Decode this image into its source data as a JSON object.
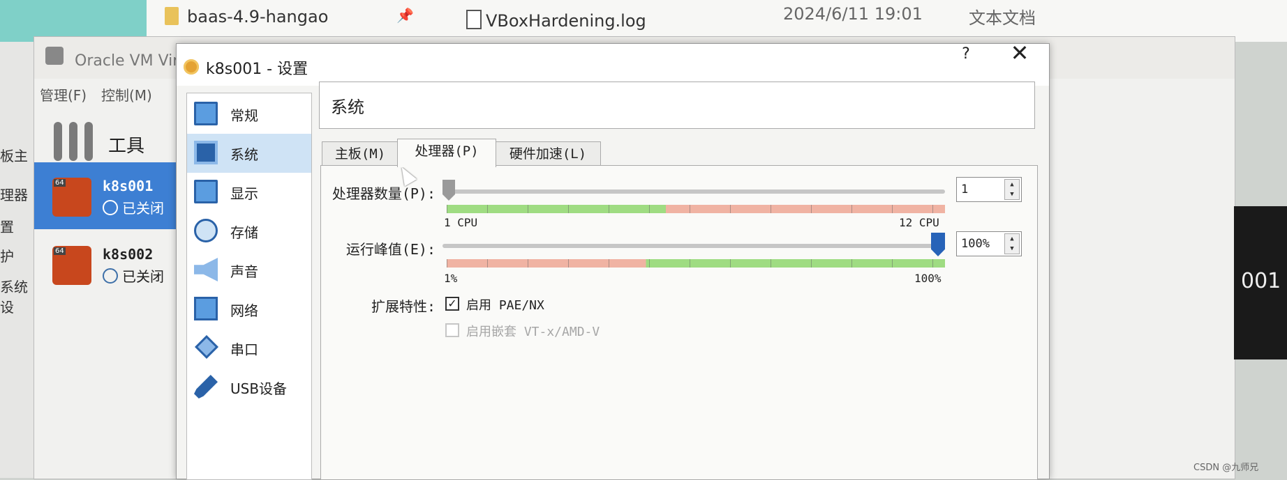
{
  "explorer": {
    "folder_name": "baas-4.9-hangao",
    "file_name": "VBoxHardening.log",
    "file_date": "2024/6/11 19:01",
    "file_type": "文本文档"
  },
  "manager": {
    "title": "Oracle VM VirtualBox 管理器",
    "menu": [
      "管理(F)",
      "控制(M)"
    ],
    "tools_label": "工具",
    "left_edge_labels": [
      "板主",
      "理器",
      "置",
      "护",
      "系统设"
    ],
    "vms": [
      {
        "name": "k8s001",
        "status": "已关闭",
        "badge": "64"
      },
      {
        "name": "k8s002",
        "status": "已关闭",
        "badge": "64"
      }
    ],
    "right_panel_text": "001"
  },
  "dialog": {
    "title": "k8s001 - 设置",
    "help": "?",
    "close": "✕",
    "categories": [
      {
        "label": "常规",
        "icon": "monitor-icon"
      },
      {
        "label": "系统",
        "icon": "chip-icon"
      },
      {
        "label": "显示",
        "icon": "display-icon"
      },
      {
        "label": "存储",
        "icon": "disk-icon"
      },
      {
        "label": "声音",
        "icon": "speaker-icon"
      },
      {
        "label": "网络",
        "icon": "network-icon"
      },
      {
        "label": "串口",
        "icon": "serial-icon"
      },
      {
        "label": "USB设备",
        "icon": "usb-icon"
      }
    ],
    "selected_category": "系统",
    "section_title": "系统",
    "tabs": [
      "主板(M)",
      "处理器(P)",
      "硬件加速(L)"
    ],
    "active_tab": "处理器(P)",
    "processor": {
      "cpu_count_label": "处理器数量(P):",
      "cpu_count_value": "1",
      "cpu_min_label": "1 CPU",
      "cpu_max_label": "12 CPU",
      "cpu_slider_fraction": 0.0,
      "exec_cap_label": "运行峰值(E):",
      "exec_cap_value": "100%",
      "exec_min_label": "1%",
      "exec_max_label": "100%",
      "exec_slider_fraction": 1.0,
      "extended_label": "扩展特性:",
      "pae_label": "启用 PAE/NX",
      "pae_checked": true,
      "nested_label": "启用嵌套 VT-x/AMD-V",
      "nested_checked": false,
      "nested_enabled": false
    }
  },
  "watermark": "CSDN @九师兄",
  "colors": {
    "selection_blue": "#3d7fd3",
    "handle_blue": "#2763b8",
    "scale_green": "#9fdc82",
    "scale_red": "#f0b3a3"
  }
}
